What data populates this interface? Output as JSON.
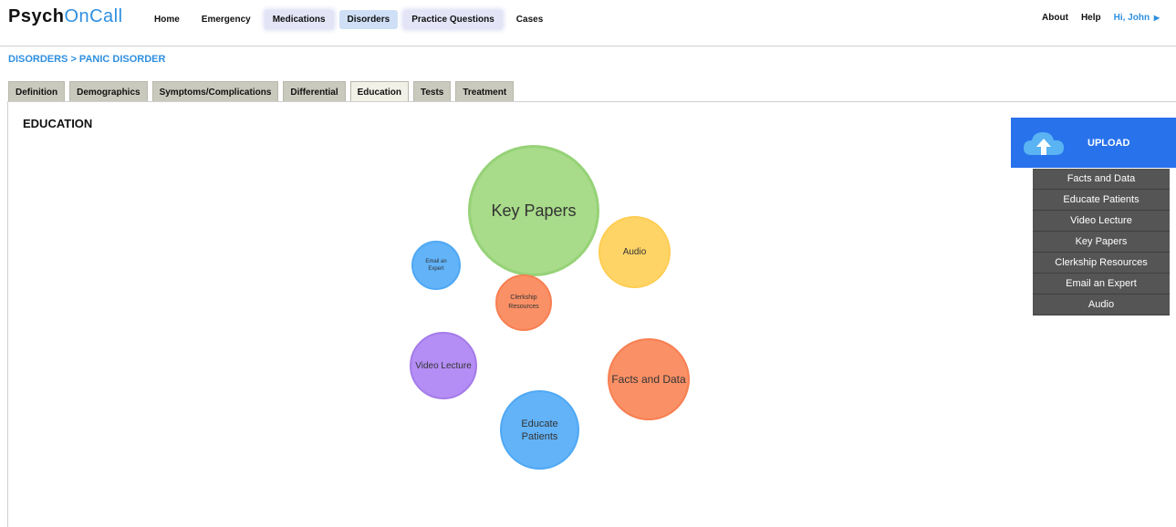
{
  "logo": {
    "part1": "Psych",
    "part2": "OnCall"
  },
  "nav": {
    "items": [
      {
        "label": "Home"
      },
      {
        "label": "Emergency"
      },
      {
        "label": "Medications"
      },
      {
        "label": "Disorders"
      },
      {
        "label": "Practice Questions"
      },
      {
        "label": "Cases"
      }
    ]
  },
  "right_nav": {
    "about": "About",
    "help": "Help",
    "user": "Hi, John"
  },
  "breadcrumb": "DISORDERS > PANIC DISORDER",
  "tabs": [
    {
      "label": "Definition"
    },
    {
      "label": "Demographics"
    },
    {
      "label": "Symptoms/Complications"
    },
    {
      "label": "Differential"
    },
    {
      "label": "Education"
    },
    {
      "label": "Tests"
    },
    {
      "label": "Treatment"
    }
  ],
  "section_title": "EDUCATION",
  "bubbles": {
    "key_papers": "Key Papers",
    "audio": "Audio",
    "email_expert": "Email an Expert",
    "clerkship": "Clerkship Resources",
    "video_lecture": "Video Lecture",
    "facts_data": "Facts and Data",
    "educate_patients": "Educate Patients"
  },
  "upload": {
    "label": "UPLOAD",
    "menu": [
      "Facts and Data",
      "Educate Patients",
      "Video Lecture",
      "Key Papers",
      "Clerkship Resources",
      "Email an Expert",
      "Audio"
    ]
  },
  "colors": {
    "accent": "#2e8fe0",
    "green": "#a8db8a",
    "yellow": "#ffd466",
    "blue": "#62b3f8",
    "orange": "#fa9066",
    "purple": "#b48ef4",
    "upload": "#2872ec"
  }
}
